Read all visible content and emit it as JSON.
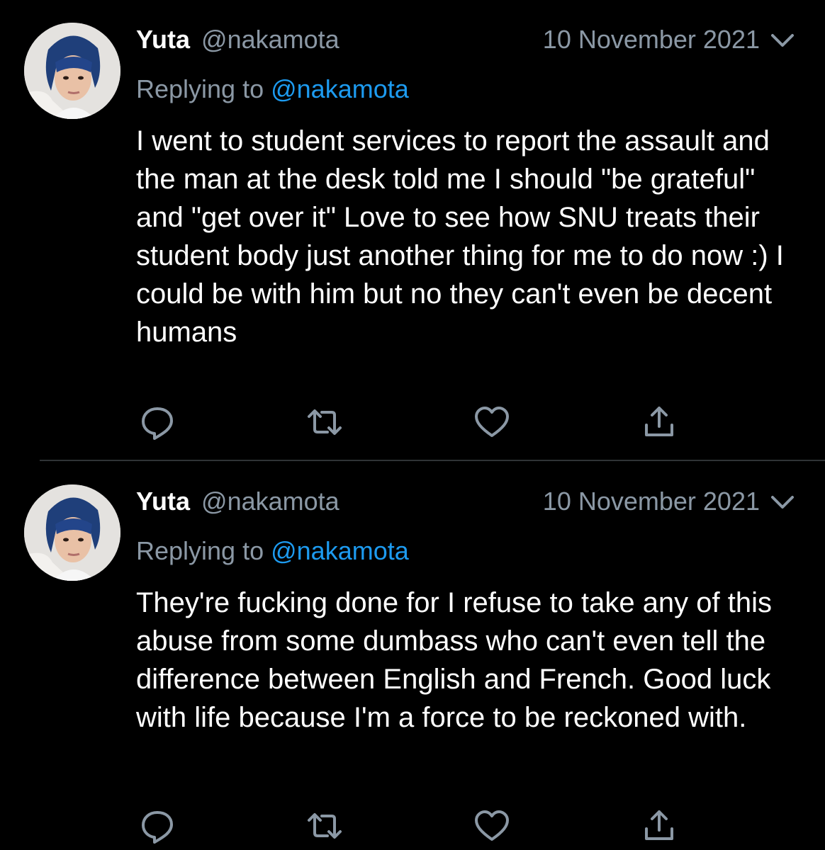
{
  "tweets": [
    {
      "name": "Yuta",
      "handle": "@nakamota",
      "date": "10 November 2021",
      "reply_prefix": "Replying to ",
      "reply_mention": "@nakamota",
      "text": "I went to student services to report the assault and the man at the desk told me I should \"be grateful\" and \"get over it\" Love to see how SNU treats their student body just another thing for me to do now :) I could be with him but no they can't even be decent humans",
      "icons": [
        "reply-icon",
        "retweet-icon",
        "like-icon",
        "share-icon"
      ]
    },
    {
      "name": "Yuta",
      "handle": "@nakamota",
      "date": "10 November 2021",
      "reply_prefix": "Replying to ",
      "reply_mention": "@nakamota",
      "text": "They're fucking done for I refuse to take any of this abuse from some dumbass who can't even tell the difference between English and French. Good luck with life because I'm a force to be reckoned with.",
      "icons": [
        "reply-icon",
        "retweet-icon",
        "like-icon",
        "share-icon"
      ]
    }
  ],
  "colors": {
    "background": "#000000",
    "text": "#ffffff",
    "secondary": "#8b98a5",
    "link": "#1d9bf0",
    "icon": "#8b98a5",
    "divider": "#2f3336"
  }
}
